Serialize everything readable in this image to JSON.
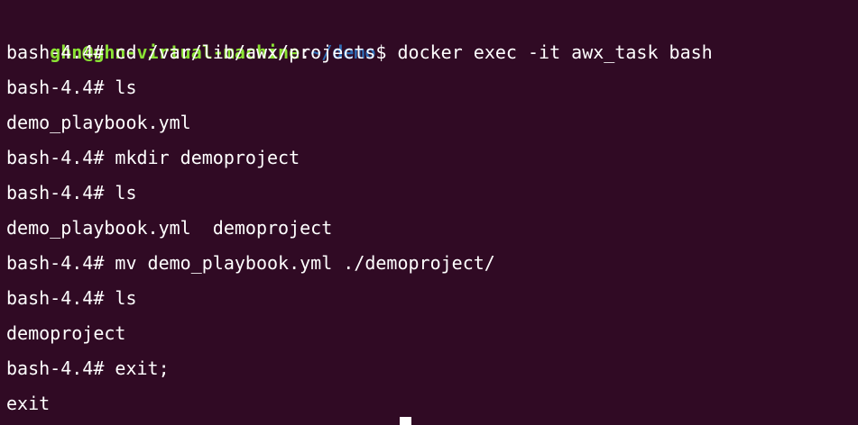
{
  "terminal": {
    "colors": {
      "background": "#300a24",
      "text": "#ffffff",
      "prompt_user": "#8ae234",
      "prompt_path": "#2f6bb5"
    },
    "prompt": {
      "user_host": "ghn@ghn-virtual-machine",
      "separator": ":",
      "path": "~/demo",
      "symbol": "$ ",
      "command": "docker exec -it awx_task bash"
    },
    "lines": [
      "bash-4.4# cd /var/lib/awx/projects",
      "bash-4.4# ls",
      "demo_playbook.yml",
      "bash-4.4# mkdir demoproject",
      "bash-4.4# ls",
      "demo_playbook.yml  demoproject",
      "bash-4.4# mv demo_playbook.yml ./demoproject/",
      "bash-4.4# ls",
      "demoproject",
      "bash-4.4# exit;",
      "exit"
    ]
  }
}
